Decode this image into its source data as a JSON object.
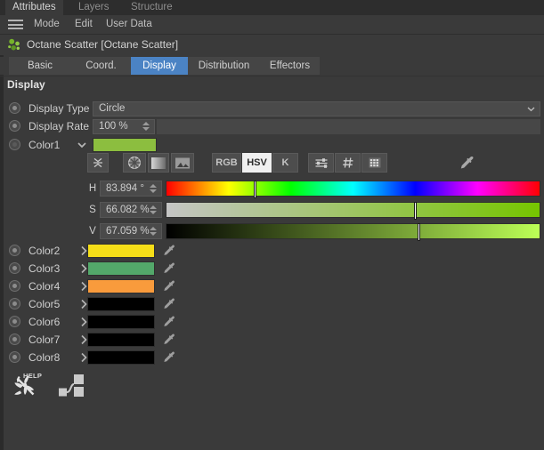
{
  "window": {
    "top_tabs": [
      {
        "label": "Attributes",
        "active": true
      },
      {
        "label": "Layers",
        "active": false
      },
      {
        "label": "Structure",
        "active": false
      }
    ],
    "menus": [
      "Mode",
      "Edit",
      "User Data"
    ],
    "toolbar_icons": [
      "back-arrow-icon",
      "forward-arrow-icon",
      "up-arrow-icon",
      "search-icon",
      "filter-icon",
      "lock-icon",
      "target-icon",
      "panel-icon"
    ]
  },
  "object": {
    "title": "Octane Scatter [Octane Scatter]",
    "icon": "octane-scatter-icon"
  },
  "tabs": [
    {
      "label": "Basic",
      "active": false
    },
    {
      "label": "Coord.",
      "active": false
    },
    {
      "label": "Display",
      "active": true
    },
    {
      "label": "Distribution",
      "active": false
    },
    {
      "label": "Effectors",
      "active": false
    }
  ],
  "section": {
    "title": "Display"
  },
  "properties": {
    "display_type": {
      "label": "Display Type",
      "value": "Circle"
    },
    "display_rate": {
      "label": "Display Rate",
      "value": "100 %"
    },
    "color1": {
      "label": "Color1",
      "color": "#8CBE3F",
      "expanded": true
    }
  },
  "color_picker": {
    "tool_icons": [
      "collapse-icon",
      "color-wheel-icon",
      "gradient-icon",
      "image-picker-icon"
    ],
    "modes": [
      {
        "label": "RGB",
        "active": false
      },
      {
        "label": "HSV",
        "active": true
      },
      {
        "label": "K",
        "active": false
      }
    ],
    "extra_icons": [
      "sliders-icon",
      "hash-icon",
      "swatch-grid-icon",
      "eyedropper-icon"
    ],
    "channels": [
      {
        "label": "H",
        "value": "83.894 °",
        "position": 23.3
      },
      {
        "label": "S",
        "value": "66.082 %",
        "position": 66.1
      },
      {
        "label": "V",
        "value": "67.059 %",
        "position": 67.1
      }
    ]
  },
  "color_list": [
    {
      "label": "Color2",
      "color": "#F5DE18"
    },
    {
      "label": "Color3",
      "color": "#53A86A"
    },
    {
      "label": "Color4",
      "color": "#F99B3C"
    },
    {
      "label": "Color5",
      "color": "#000000"
    },
    {
      "label": "Color6",
      "color": "#000000"
    },
    {
      "label": "Color7",
      "color": "#000000"
    },
    {
      "label": "Color8",
      "color": "#000000"
    }
  ],
  "footer": {
    "help_label": "HELP",
    "icons": [
      "octane-help-icon",
      "node-graph-icon"
    ]
  },
  "theme": {
    "accent": "#4b83c4",
    "background": "#3a3a3a",
    "panel": "#4a4a4a"
  }
}
